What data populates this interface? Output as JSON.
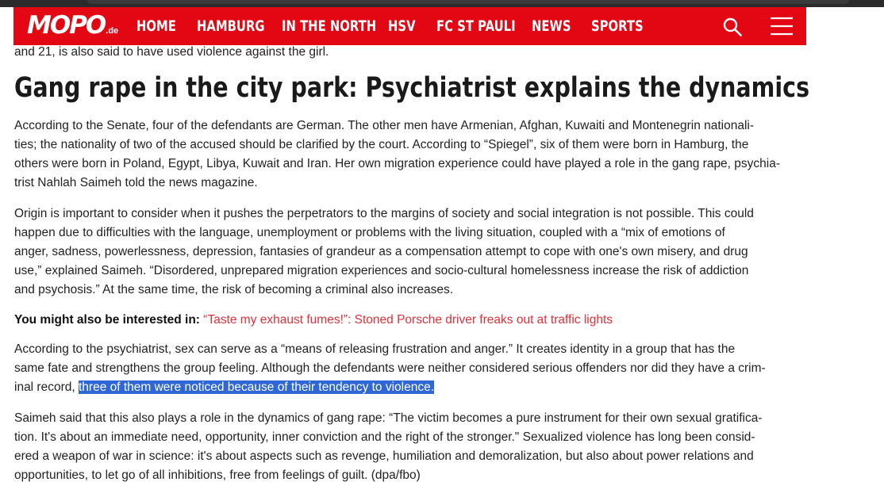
{
  "nav": {
    "logo_text": "MOPO",
    "logo_tld": ".de",
    "items": [
      "HOME",
      "HAMBURG",
      "IN THE NORTH",
      "HSV",
      "FC ST PAULI",
      "NEWS",
      "SPORTS"
    ],
    "search_icon": "search-icon",
    "menu_icon": "hamburger-menu-icon",
    "bg_color": "#e30613"
  },
  "article": {
    "clipped_line": "and 21, is also said to have used violence against the girl.",
    "headline": "Gang rape in the city park: Psychiatrist explains the dynamics",
    "p1": [
      "According to the Senate, four of the defendants are German. The other men have Armenian, Afghan, Kuwaiti and Montenegrin nationali-",
      "ties; the nationality of two of the accused should be clarified by the court. According to “Spiegel”, six of them were born in Hamburg, the",
      "others were born in Poland, Egypt, Libya, Kuwait and Iran. Her own migration experience could have played a role in the gang rape, psychia-",
      "trist Nahlah Saimeh told the news magazine."
    ],
    "p2": [
      "Origin is important to consider when it pushes the perpetrators to the margins of society and social integration is not possible. This could",
      "happen due to difficulties with the language, unemployment or problems with the living situation, coupled with a “mix of emotions of",
      "anger, sadness, powerlessness, depression, fantasies of grandeur as a compensation attempt to cope with one's own misery, and drug",
      "use,” explained Saimeh. “Disordered, unprepared migration experiences and socio-cultural homelessness increase the risk of addiction",
      "and psychosis.” At the same time, the risk of becoming a criminal also increases."
    ],
    "related_label": "You might also be interested in:",
    "related_link": "“Taste my exhaust fumes!”: Stoned Porsche driver freaks out at traffic lights",
    "p4": [
      "According to the psychiatrist, sex can serve as a “means of releasing frustration and anger.” It creates identity in a group that has the",
      "same fate and strengthens the group feeling. Although the defendants were neither considered serious offenders nor did they have a crim-"
    ],
    "p4_last_prefix": "inal record, ",
    "p4_selected": "three of them were noticed because of their tendency to violence.",
    "p5": [
      "Saimeh said that this also plays a role in the dynamics of gang rape: “The victim becomes a pure instrument for their own sexual gratifica-",
      "tion. It's about an immediate need, opportunity, inner conviction and the right of the stronger.\" Sexualized violence has long been consid-",
      "ered a weapon of war in science: it's about aspects such as revenge, humiliation and demoralization, but also about power relations and",
      "opportunities, to let go of all inhibitions, free from feelings of guilt. (dpa/fbo)"
    ],
    "link_color": "#e0303a",
    "selection_color": "#2f67d6"
  }
}
